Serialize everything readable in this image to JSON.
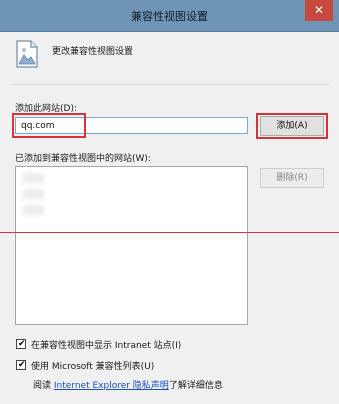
{
  "window": {
    "title": "兼容性视图设置",
    "close_glyph": "✕"
  },
  "header": {
    "icon": "compatibility-view-page-icon",
    "text": "更改兼容性视图设置"
  },
  "add_site": {
    "label": "添加此网站(D):",
    "input_value": "qq.com",
    "add_button": "添加(A)"
  },
  "site_list": {
    "label": "已添加到兼容性视图中的网站(W):",
    "delete_button": "删除(R)",
    "items_blurred": 3
  },
  "options": {
    "intranet": {
      "label": "在兼容性视图中显示 Intranet 站点(I)",
      "checked": true
    },
    "ms_list": {
      "label": "使用 Microsoft 兼容性列表(U)",
      "checked": true
    }
  },
  "footer": {
    "prefix": "阅读 ",
    "link": "Internet Explorer 隐私声明",
    "suffix": "了解详细信息"
  },
  "colors": {
    "titlebar": "#6e95b6",
    "highlight_red": "#d6333a",
    "link": "#1a4fc2"
  }
}
